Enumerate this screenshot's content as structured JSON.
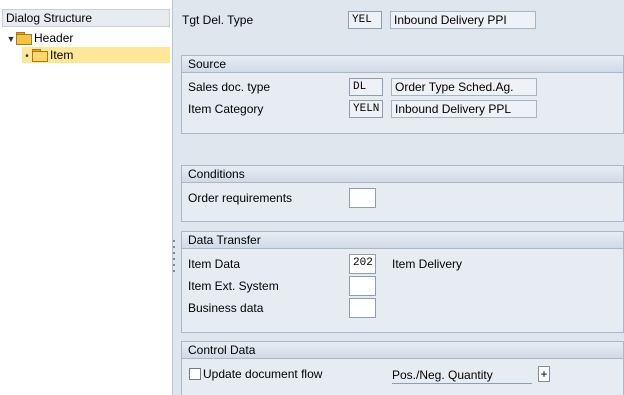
{
  "dialog_structure": {
    "title": "Dialog Structure",
    "nodes": [
      {
        "label": "Header",
        "expanded": true,
        "selected": false
      },
      {
        "label": "Item",
        "selected": true
      }
    ]
  },
  "top": {
    "tgt_del_type_label": "Tgt Del. Type",
    "tgt_del_type_value": "YEL",
    "tgt_del_type_desc": "Inbound Delivery PPI"
  },
  "source": {
    "title": "Source",
    "sales_doc_type_label": "Sales doc. type",
    "sales_doc_type_value": "DL",
    "sales_doc_type_desc": "Order Type Sched.Ag.",
    "item_category_label": "Item Category",
    "item_category_value": "YELN",
    "item_category_desc": "Inbound Delivery PPL"
  },
  "conditions": {
    "title": "Conditions",
    "order_requirements_label": "Order requirements",
    "order_requirements_value": ""
  },
  "data_transfer": {
    "title": "Data Transfer",
    "item_data_label": "Item Data",
    "item_data_value": "202",
    "item_data_desc": "Item Delivery",
    "item_ext_system_label": "Item Ext. System",
    "item_ext_system_value": "",
    "business_data_label": "Business data",
    "business_data_value": ""
  },
  "control_data": {
    "title": "Control Data",
    "update_doc_flow_label": "Update document flow",
    "update_doc_flow_checked": false,
    "pos_neg_qty_label": "Pos./Neg. Quantity",
    "pos_neg_qty_value": "+"
  },
  "colors": {
    "selection": "#ffe79a",
    "background": "#dfe6ee",
    "group_title": "#cfdbe8"
  }
}
